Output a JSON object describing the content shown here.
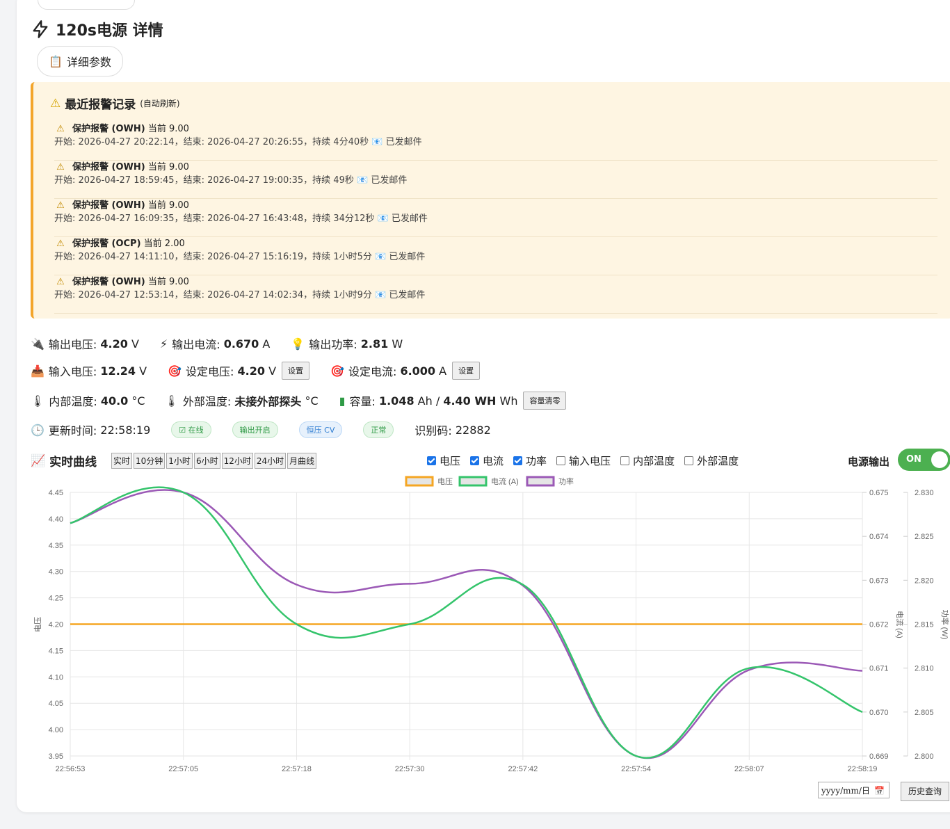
{
  "header": {
    "title": "120s电源 详情",
    "detail_button": "详细参数"
  },
  "alarms": {
    "title": "最近报警记录",
    "subtitle": "(自动刷新)",
    "items": [
      {
        "type": "保护报警 (OWH)",
        "current": "当前 9.00",
        "detail": "开始: 2026-04-27 20:22:14，结束: 2026-04-27 20:26:55，持续 4分40秒",
        "mail": "已发邮件"
      },
      {
        "type": "保护报警 (OWH)",
        "current": "当前 9.00",
        "detail": "开始: 2026-04-27 18:59:45，结束: 2026-04-27 19:00:35，持续 49秒",
        "mail": "已发邮件"
      },
      {
        "type": "保护报警 (OWH)",
        "current": "当前 9.00",
        "detail": "开始: 2026-04-27 16:09:35，结束: 2026-04-27 16:43:48，持续 34分12秒",
        "mail": "已发邮件"
      },
      {
        "type": "保护报警 (OCP)",
        "current": "当前 2.00",
        "detail": "开始: 2026-04-27 14:11:10，结束: 2026-04-27 15:16:19，持续 1小时5分",
        "mail": "已发邮件"
      },
      {
        "type": "保护报警 (OWH)",
        "current": "当前 9.00",
        "detail": "开始: 2026-04-27 12:53:14，结束: 2026-04-27 14:02:34，持续 1小时9分",
        "mail": "已发邮件"
      }
    ]
  },
  "stats": {
    "out_v_label": "输出电压:",
    "out_v": "4.20",
    "out_v_unit": "V",
    "out_i_label": "输出电流:",
    "out_i": "0.670",
    "out_i_unit": "A",
    "out_p_label": "输出功率:",
    "out_p": "2.81",
    "out_p_unit": "W",
    "in_v_label": "输入电压:",
    "in_v": "12.24",
    "in_v_unit": "V",
    "set_v_label": "设定电压:",
    "set_v": "4.20",
    "set_v_unit": "V",
    "set_i_label": "设定电流:",
    "set_i": "6.000",
    "set_i_unit": "A",
    "set_btn": "设置",
    "int_t_label": "内部温度:",
    "int_t": "40.0",
    "int_t_unit": "°C",
    "ext_t_label": "外部温度:",
    "ext_t": "未接外部探头",
    "ext_t_unit": "°C",
    "cap_label": "容量:",
    "cap_ah": "1.048",
    "cap_ah_unit": "Ah /",
    "cap_wh": "4.40 WH",
    "cap_wh_unit": "Wh",
    "cap_clear": "容量清零",
    "update_label": "更新时间:",
    "update_time": "22:58:19",
    "pill_online": "在线",
    "pill_output": "输出开启",
    "pill_mode": "恒压 CV",
    "pill_status": "正常",
    "id_label": "识别码:",
    "id_value": "22882"
  },
  "chart_controls": {
    "title": "实时曲线",
    "ranges": [
      "实时",
      "10分钟",
      "1小时",
      "6小时",
      "12小时",
      "24小时",
      "月曲线"
    ],
    "checks": [
      {
        "label": "电压",
        "checked": true
      },
      {
        "label": "电流",
        "checked": true
      },
      {
        "label": "功率",
        "checked": true
      },
      {
        "label": "输入电压",
        "checked": false
      },
      {
        "label": "内部温度",
        "checked": false
      },
      {
        "label": "外部温度",
        "checked": false
      }
    ],
    "power_label": "电源输出",
    "toggle": "ON",
    "date_placeholder": "yyyy/mm/日",
    "history_btn": "历史查询"
  },
  "chart_data": {
    "type": "line",
    "x": [
      "22:56:53",
      "22:57:05",
      "22:57:18",
      "22:57:30",
      "22:57:42",
      "22:57:54",
      "22:58:07",
      "22:58:19"
    ],
    "series": [
      {
        "name": "电压",
        "axis": "left",
        "color": "#f5a623",
        "values": [
          4.2,
          4.2,
          4.2,
          4.2,
          4.2,
          4.2,
          4.2,
          4.2
        ]
      },
      {
        "name": "电流 (A)",
        "axis": "right1",
        "color": "#34c46b",
        "values": [
          0.6743,
          0.675,
          0.672,
          0.672,
          0.6729,
          0.669,
          0.671,
          0.67
        ]
      },
      {
        "name": "功率",
        "axis": "right2",
        "color": "#9b59b6",
        "values": [
          2.8265,
          2.83,
          2.8195,
          2.8196,
          2.8194,
          2.8,
          2.8098,
          2.8097
        ]
      }
    ],
    "y_left": {
      "label": "电压",
      "min": 3.95,
      "max": 4.45,
      "ticks": [
        "3.95",
        "4.00",
        "4.05",
        "4.10",
        "4.15",
        "4.20",
        "4.25",
        "4.30",
        "4.35",
        "4.40",
        "4.45"
      ]
    },
    "y_right1": {
      "label": "电流 (A)",
      "min": 0.669,
      "max": 0.675,
      "ticks": [
        "0.669",
        "0.670",
        "0.671",
        "0.672",
        "0.673",
        "0.674",
        "0.675"
      ]
    },
    "y_right2": {
      "label": "功率 (W)",
      "min": 2.8,
      "max": 2.83,
      "ticks": [
        "2.800",
        "2.805",
        "2.810",
        "2.815",
        "2.820",
        "2.825",
        "2.830"
      ]
    },
    "grid": true,
    "legend": "top-center"
  }
}
